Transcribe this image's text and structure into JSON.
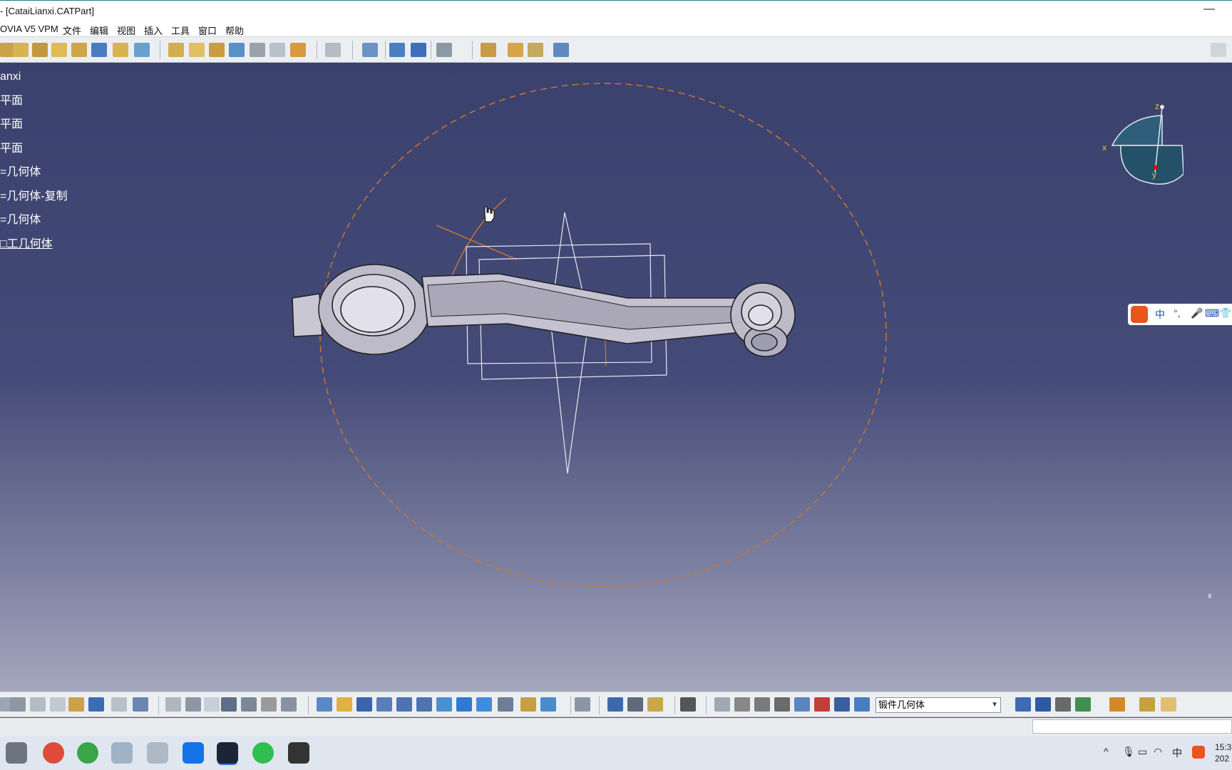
{
  "window": {
    "title": "- [CataiLianxi.CATPart]",
    "minimize_label": "—"
  },
  "menu": {
    "items": [
      "OVIA V5 VPM",
      "文件",
      "编辑",
      "视图",
      "插入",
      "工具",
      "窗口",
      "帮助"
    ]
  },
  "tree": {
    "items": [
      "anxi",
      "平面",
      "平面",
      "平面",
      "=几何体",
      "=几何体-复制",
      "=几何体",
      "□工几何体"
    ],
    "active_index": 7
  },
  "compass": {
    "labels": {
      "x": "x",
      "y": "y",
      "z": "z"
    }
  },
  "ime": {
    "lang": "中",
    "punct": "°,",
    "mic": "🎤",
    "kbd": "⌨",
    "skin": "👕"
  },
  "bottom_toolbar": {
    "current_body": "锻件几何体"
  },
  "taskbar": {
    "tray_lang": "中",
    "clock_time": "15:3",
    "clock_date": "202"
  },
  "colors": {
    "viewport_top": "#3b416d",
    "viewport_bottom": "#a4a7bd",
    "sketch_orange": "#d4762c",
    "plane_white": "#e8e8f0"
  }
}
